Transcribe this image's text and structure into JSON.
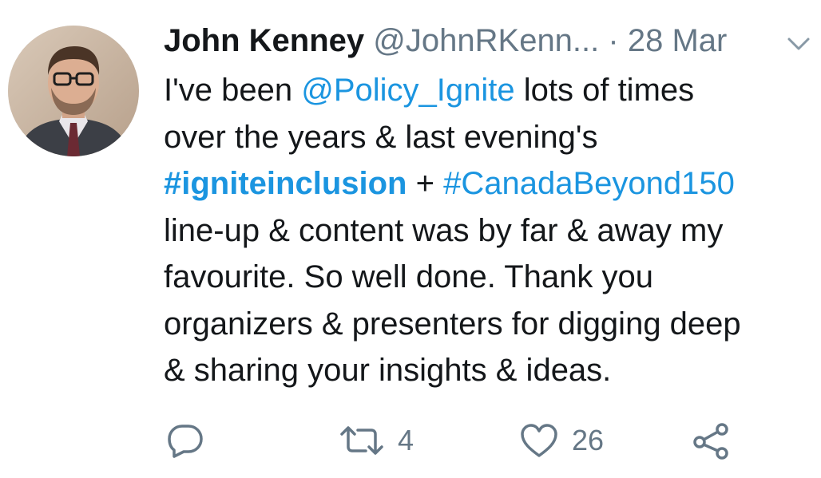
{
  "tweet": {
    "author_name": "John Kenney",
    "author_handle": "@JohnRKenn...",
    "separator": "·",
    "date": "28 Mar",
    "body": {
      "line1_pre": "I've been ",
      "line1_mention": "@Policy_Ignite",
      "line1_post": " lots of times",
      "line2": "over the years & last evening's",
      "line3_hashtag1": "#igniteinclusion",
      "line3_plus": " + ",
      "line3_hashtag2": "#CanadaBeyond150",
      "line4": "line-up & content was by far & away my",
      "line5": "favourite. So well done. Thank you",
      "line6": "organizers & presenters for digging deep",
      "line7": "& sharing your insights & ideas."
    },
    "actions": {
      "reply_icon": "reply-icon",
      "retweet_icon": "retweet-icon",
      "retweet_count": "4",
      "like_icon": "heart-icon",
      "like_count": "26",
      "share_icon": "share-icon"
    },
    "colors": {
      "link": "#1b95e0",
      "text": "#14171a",
      "secondary": "#657786"
    }
  }
}
